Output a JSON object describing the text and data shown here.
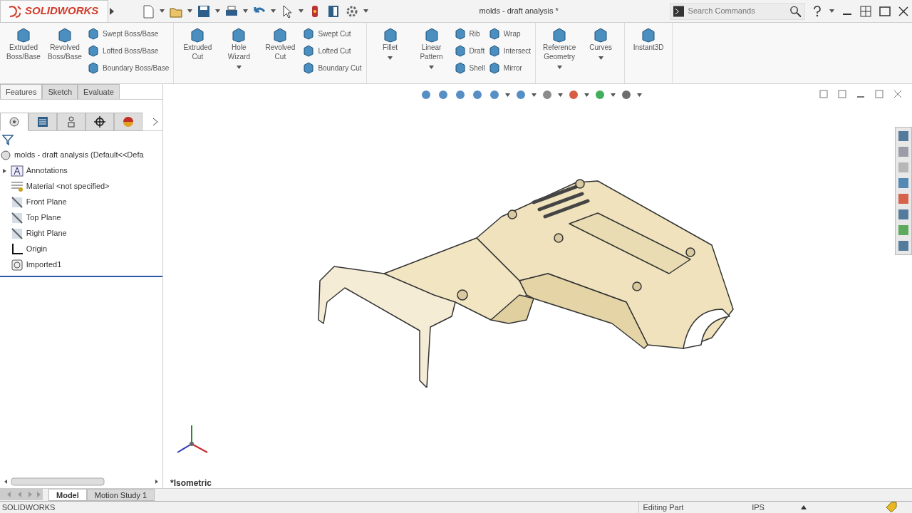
{
  "window": {
    "logo": "SOLIDWORKS",
    "title": "molds - draft analysis *"
  },
  "search": {
    "placeholder": "Search Commands"
  },
  "ribbon": {
    "groups": [
      {
        "items": [
          {
            "kind": "large",
            "label": "Extruded\nBoss/Base",
            "dropdown": false
          },
          {
            "kind": "large",
            "label": "Revolved\nBoss/Base",
            "dropdown": false
          },
          {
            "kind": "stack",
            "items": [
              {
                "label": "Swept Boss/Base"
              },
              {
                "label": "Lofted Boss/Base"
              },
              {
                "label": "Boundary Boss/Base"
              }
            ]
          }
        ]
      },
      {
        "items": [
          {
            "kind": "large",
            "label": "Extruded\nCut",
            "dropdown": false
          },
          {
            "kind": "large",
            "label": "Hole\nWizard",
            "dropdown": true
          },
          {
            "kind": "large",
            "label": "Revolved\nCut",
            "dropdown": false
          },
          {
            "kind": "stack",
            "items": [
              {
                "label": "Swept Cut"
              },
              {
                "label": "Lofted Cut"
              },
              {
                "label": "Boundary Cut"
              }
            ]
          }
        ]
      },
      {
        "items": [
          {
            "kind": "large",
            "label": "Fillet",
            "dropdown": true
          },
          {
            "kind": "large",
            "label": "Linear\nPattern",
            "dropdown": true
          },
          {
            "kind": "stack",
            "items": [
              {
                "label": "Rib"
              },
              {
                "label": "Draft"
              },
              {
                "label": "Shell"
              }
            ]
          },
          {
            "kind": "stack",
            "items": [
              {
                "label": "Wrap"
              },
              {
                "label": "Intersect"
              },
              {
                "label": "Mirror"
              }
            ]
          }
        ]
      },
      {
        "items": [
          {
            "kind": "large",
            "label": "Reference\nGeometry",
            "dropdown": true
          },
          {
            "kind": "large",
            "label": "Curves",
            "dropdown": true
          }
        ]
      },
      {
        "items": [
          {
            "kind": "large",
            "label": "Instant3D",
            "dropdown": false
          }
        ]
      }
    ]
  },
  "command_tabs": [
    {
      "label": "Features",
      "selected": true
    },
    {
      "label": "Sketch",
      "selected": false
    },
    {
      "label": "Evaluate",
      "selected": false
    }
  ],
  "panel_tabs": [
    {
      "kind": "tree",
      "selected": true
    },
    {
      "kind": "property",
      "selected": false
    },
    {
      "kind": "config",
      "selected": false
    },
    {
      "kind": "target",
      "selected": false
    },
    {
      "kind": "display",
      "selected": false
    }
  ],
  "tree": {
    "root": "molds - draft analysis  (Default<<Defa",
    "items": [
      {
        "kind": "annotations",
        "label": "Annotations",
        "expander": true
      },
      {
        "kind": "material",
        "label": "Material <not specified>",
        "expander": false
      },
      {
        "kind": "plane",
        "label": "Front Plane",
        "expander": false
      },
      {
        "kind": "plane",
        "label": "Top Plane",
        "expander": false
      },
      {
        "kind": "plane",
        "label": "Right Plane",
        "expander": false
      },
      {
        "kind": "origin",
        "label": "Origin",
        "expander": false
      },
      {
        "kind": "imported",
        "label": "Imported1",
        "expander": false
      }
    ]
  },
  "viewport": {
    "view_label": "*Isometric"
  },
  "bottom_tabs": [
    {
      "label": "Model",
      "selected": true
    },
    {
      "label": "Motion Study 1",
      "selected": false
    }
  ],
  "status_bar": {
    "app": "SOLIDWORKS",
    "mode": "Editing Part",
    "units": "IPS"
  }
}
